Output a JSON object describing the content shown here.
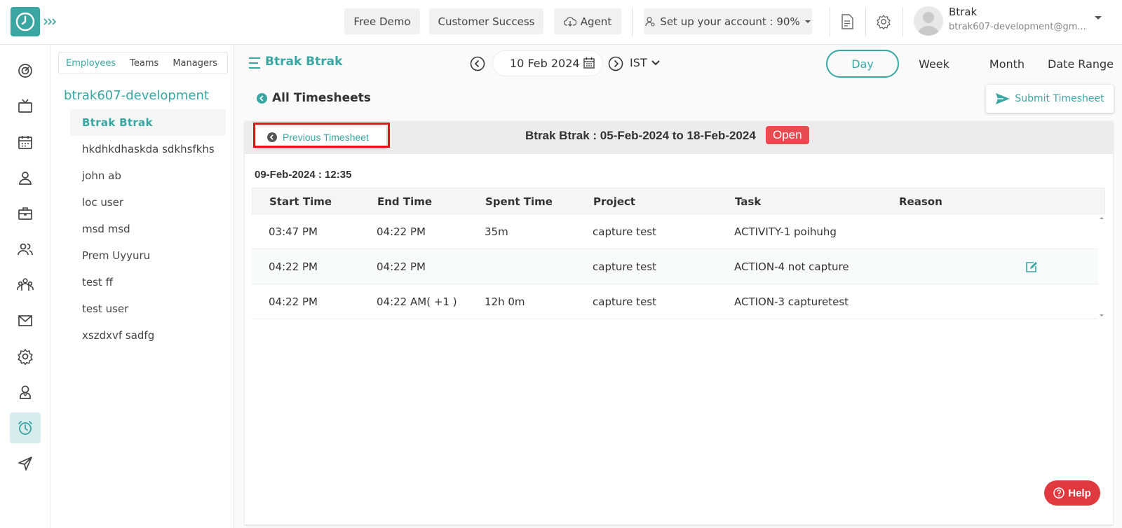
{
  "header": {
    "free_demo": "Free Demo",
    "customer_success": "Customer Success",
    "agent": "Agent",
    "setup": "Set up your account : 90%",
    "user_name": "Btrak",
    "user_email": "btrak607-development@gm..."
  },
  "employee_panel": {
    "tabs": [
      "Employees",
      "Teams",
      "Managers"
    ],
    "org": "btrak607-development",
    "employees": [
      "Btrak Btrak",
      "hkdhkdhaskda sdkhsfkhs",
      "john ab",
      "loc user",
      "msd msd",
      "Prem Uyyuru",
      "test ff",
      "test user",
      "xszdxvf sadfg"
    ]
  },
  "toolbar": {
    "employee": "Btrak Btrak",
    "date": "10 Feb 2024",
    "timezone": "IST",
    "views": [
      "Day",
      "Week",
      "Month",
      "Date Range"
    ],
    "active_view": "Day"
  },
  "page": {
    "title": "All Timesheets",
    "submit_label": "Submit Timesheet"
  },
  "timesheet": {
    "prev_label": "Previous Timesheet",
    "title": "Btrak Btrak : 05-Feb-2024 to 18-Feb-2024",
    "status": "Open",
    "day_label": "09-Feb-2024 : 12:35",
    "columns": [
      "Start Time",
      "End Time",
      "Spent Time",
      "Project",
      "Task",
      "Reason"
    ],
    "rows": [
      {
        "start": "03:47 PM",
        "end": "04:22 PM",
        "spent": "35m",
        "project": "capture test",
        "task": "ACTIVITY-1 poihuhg",
        "reason": ""
      },
      {
        "start": "04:22 PM",
        "end": "04:22 PM",
        "spent": "",
        "project": "capture test",
        "task": "ACTION-4 not capture",
        "reason": ""
      },
      {
        "start": "04:22 PM",
        "end": "04:22 AM( +1 )",
        "spent": "12h 0m",
        "project": "capture test",
        "task": "ACTION-3 capturetest",
        "reason": ""
      }
    ]
  },
  "help_label": "Help",
  "colors": {
    "accent": "#3aa6a2",
    "status_open": "#e84a50",
    "help": "#e03a3e",
    "highlight": "#e0141a"
  }
}
